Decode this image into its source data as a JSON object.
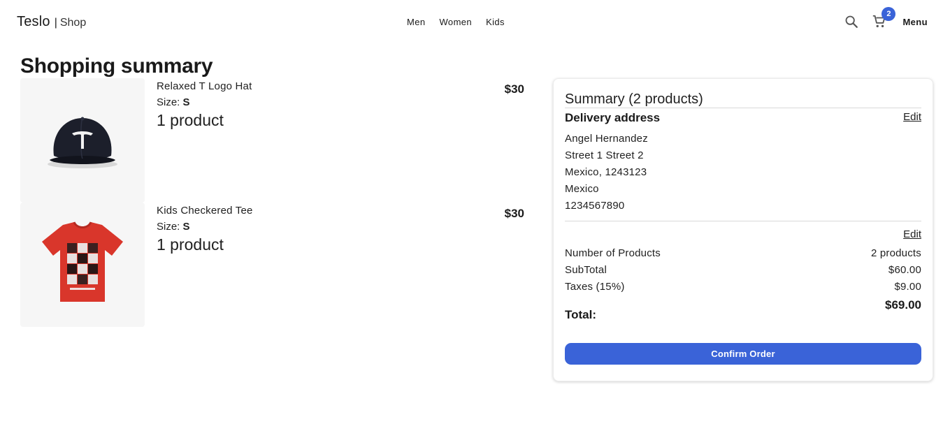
{
  "header": {
    "brand": "Teslo",
    "separator": "|",
    "shop": "Shop",
    "nav": [
      {
        "label": "Men"
      },
      {
        "label": "Women"
      },
      {
        "label": "Kids"
      }
    ],
    "cart_count": "2",
    "menu_label": "Menu",
    "icons": [
      "search-icon",
      "cart-icon"
    ]
  },
  "page": {
    "title": "Shopping summary"
  },
  "cart": {
    "items": [
      {
        "title": "Relaxed T Logo Hat",
        "size_label": "Size:",
        "size": "S",
        "quantity": "1 product",
        "price": "$30",
        "image": "cap-icon"
      },
      {
        "title": "Kids Checkered Tee",
        "size_label": "Size:",
        "size": "S",
        "quantity": "1 product",
        "price": "$30",
        "image": "tshirt-icon"
      }
    ]
  },
  "summary": {
    "title": "Summary (2 products)",
    "address_title": "Delivery address",
    "edit_label": "Edit",
    "address_lines": [
      "Angel Hernandez",
      "Street 1 Street 2",
      "Mexico, 1243123",
      "Mexico",
      "1234567890"
    ],
    "rows": [
      {
        "label": "Number of Products",
        "value": "2 products"
      },
      {
        "label": "SubTotal",
        "value": "$60.00"
      },
      {
        "label": "Taxes (15%)",
        "value": "$9.00"
      }
    ],
    "total_label": "Total:",
    "total_value": "$69.00",
    "confirm_label": "Confirm Order"
  },
  "colors": {
    "accent": "#3a63d8",
    "shirt": "#d9362b",
    "cap": "#1c1f2b"
  }
}
